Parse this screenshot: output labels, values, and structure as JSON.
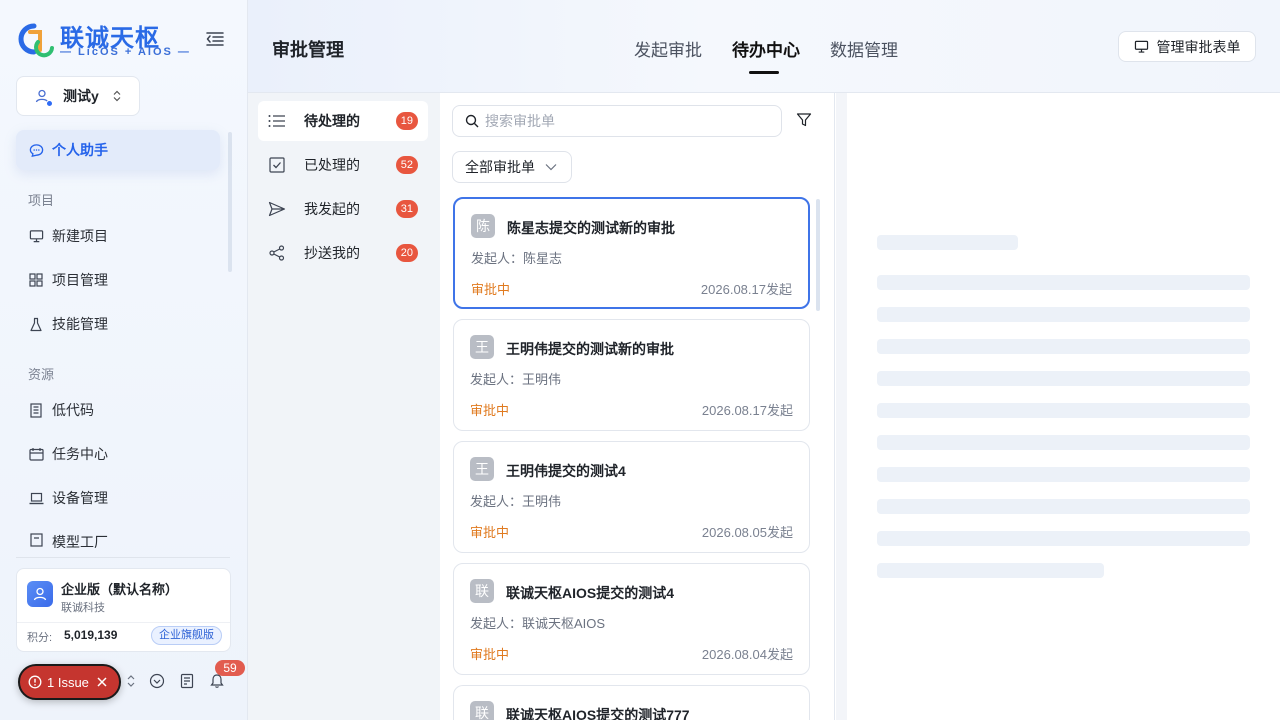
{
  "brand": {
    "name": "联诚天枢",
    "sub": "— LicOS + AIOS —",
    "colors": {
      "primary": "#2a6ae6",
      "accent_green": "#2fbf71",
      "accent_orange": "#f0a23a"
    }
  },
  "workspace": {
    "name": "测试y"
  },
  "sidebar": {
    "assistant": {
      "label": "个人助手",
      "icon": "chat-icon"
    },
    "sections": [
      {
        "title": "项目",
        "items": [
          {
            "label": "新建项目",
            "icon": "monitor-icon"
          },
          {
            "label": "项目管理",
            "icon": "grid-icon"
          },
          {
            "label": "技能管理",
            "icon": "flask-icon"
          }
        ]
      },
      {
        "title": "资源",
        "items": [
          {
            "label": "低代码",
            "icon": "building-icon"
          },
          {
            "label": "任务中心",
            "icon": "calendar-icon"
          },
          {
            "label": "设备管理",
            "icon": "laptop-icon"
          },
          {
            "label": "模型工厂",
            "icon": "factory-icon"
          }
        ]
      }
    ],
    "enterprise": {
      "name": "企业版（默认名称）",
      "org": "联诚科技",
      "points_label": "积分:",
      "points": "5,019,139",
      "plan": "企业旗舰版"
    },
    "issue": {
      "label": "1 Issue"
    },
    "notifications": {
      "count": "59"
    }
  },
  "header": {
    "title": "审批管理",
    "tabs": [
      {
        "label": "发起审批",
        "active": false
      },
      {
        "label": "待办中心",
        "active": true
      },
      {
        "label": "数据管理",
        "active": false
      }
    ],
    "manage_button": "管理审批表单"
  },
  "filters": [
    {
      "label": "待处理的",
      "count": "19",
      "icon": "list-icon",
      "active": true
    },
    {
      "label": "已处理的",
      "count": "52",
      "icon": "checkbox-icon",
      "active": false
    },
    {
      "label": "我发起的",
      "count": "31",
      "icon": "send-icon",
      "active": false
    },
    {
      "label": "抄送我的",
      "count": "20",
      "icon": "share-icon",
      "active": false
    }
  ],
  "list": {
    "search_placeholder": "搜索审批单",
    "type_filter": "全部审批单",
    "items": [
      {
        "avatar": "陈",
        "title": "陈星志提交的测试新的审批",
        "initiator": "发起人：陈星志",
        "status": "审批中",
        "date": "2026.08.17发起",
        "selected": true
      },
      {
        "avatar": "王",
        "title": "王明伟提交的测试新的审批",
        "initiator": "发起人：王明伟",
        "status": "审批中",
        "date": "2026.08.17发起",
        "selected": false
      },
      {
        "avatar": "王",
        "title": "王明伟提交的测试4",
        "initiator": "发起人：王明伟",
        "status": "审批中",
        "date": "2026.08.05发起",
        "selected": false
      },
      {
        "avatar": "联",
        "title": "联诚天枢AIOS提交的测试4",
        "initiator": "发起人：联诚天枢AIOS",
        "status": "审批中",
        "date": "2026.08.04发起",
        "selected": false
      },
      {
        "avatar": "联",
        "title": "联诚天枢AIOS提交的测试777",
        "initiator": "",
        "status": "",
        "date": "",
        "selected": false
      }
    ]
  }
}
